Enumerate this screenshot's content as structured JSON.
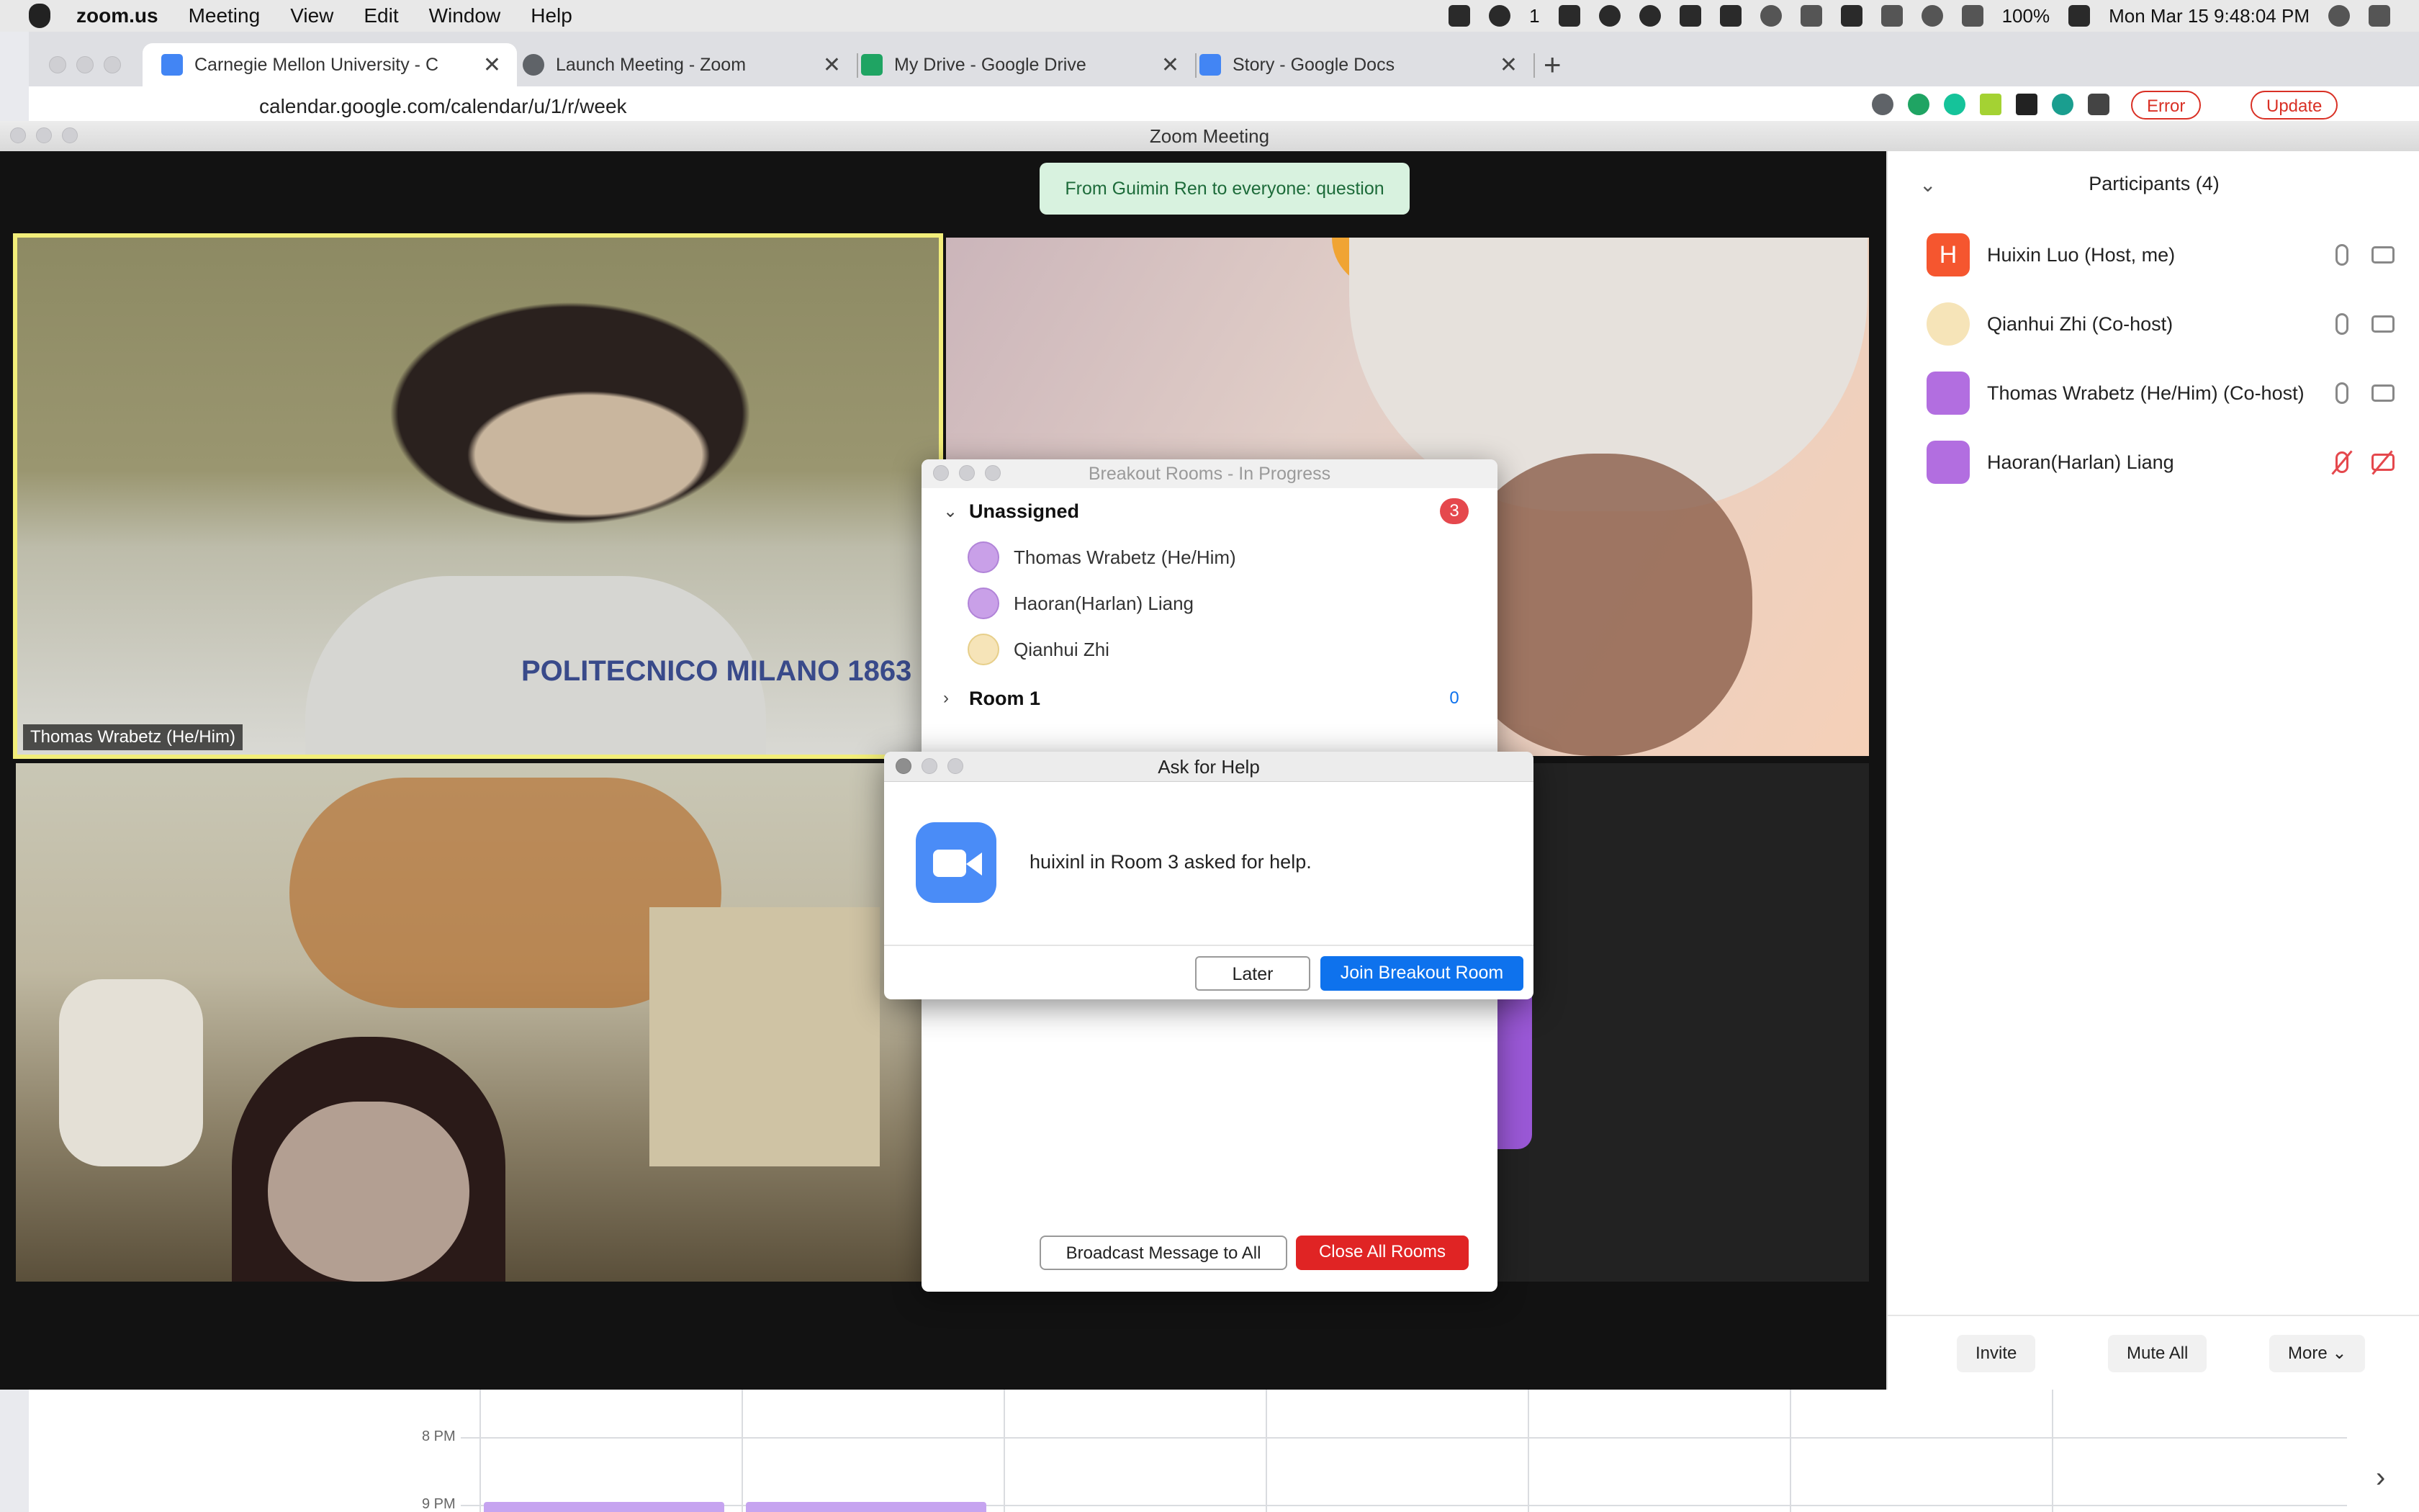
{
  "menubar": {
    "app_name": "zoom.us",
    "menus": [
      "Meeting",
      "View",
      "Edit",
      "Window",
      "Help"
    ],
    "wechat_count": "1",
    "battery": "100%",
    "datetime": "Mon Mar 15  9:48:04 PM"
  },
  "browser": {
    "tabs": [
      {
        "label": "Carnegie Mellon University - C",
        "icon": "calendar-icon",
        "color": "#4285f4"
      },
      {
        "label": "Launch Meeting - Zoom",
        "icon": "globe-icon",
        "color": "#5f6368"
      },
      {
        "label": "My Drive - Google Drive",
        "icon": "drive-icon",
        "color": "#1fa463"
      },
      {
        "label": "Story - Google Docs",
        "icon": "docs-icon",
        "color": "#4285f4"
      }
    ],
    "url": "calendar.google.com/calendar/u/1/r/week",
    "error_pill": "Error",
    "update_pill": "Update"
  },
  "zoom": {
    "window_title": "Zoom Meeting",
    "chat_toast": "From Guimin Ren to everyone: question",
    "tiles": {
      "t1_label": "Thomas Wrabetz (He/Him)",
      "t1_shirt": "POLITECNICO MILANO 1863"
    }
  },
  "participants": {
    "title": "Participants (4)",
    "rows": [
      {
        "name": "Huixin Luo (Host, me)",
        "avatar": "H",
        "avatar_color": "#f5562f",
        "muted": false
      },
      {
        "name": "Qianhui Zhi (Co-host)",
        "avatar": "",
        "avatar_color": "#f6e4b8",
        "muted": false
      },
      {
        "name": "Thomas Wrabetz (He/Him) (Co-host)",
        "avatar": "",
        "avatar_color": "#b26ee0",
        "muted": false
      },
      {
        "name": "Haoran(Harlan) Liang",
        "avatar": "",
        "avatar_color": "#b26ee0",
        "muted": true
      }
    ],
    "invite": "Invite",
    "mute_all": "Mute All",
    "more": "More"
  },
  "breakout": {
    "title": "Breakout Rooms - In Progress",
    "unassigned_label": "Unassigned",
    "unassigned_count": "3",
    "members": [
      "Thomas Wrabetz (He/Him)",
      "Haoran(Harlan) Liang",
      "Qianhui Zhi"
    ],
    "room1_label": "Room 1",
    "room1_count": "0",
    "broadcast": "Broadcast Message to All",
    "close_all": "Close All Rooms"
  },
  "help_dialog": {
    "title": "Ask for Help",
    "message": "huixinl in Room 3 asked for help.",
    "later": "Later",
    "join": "Join Breakout Room"
  },
  "calendar": {
    "time_8pm": "8 PM",
    "time_9pm": "9 PM"
  }
}
